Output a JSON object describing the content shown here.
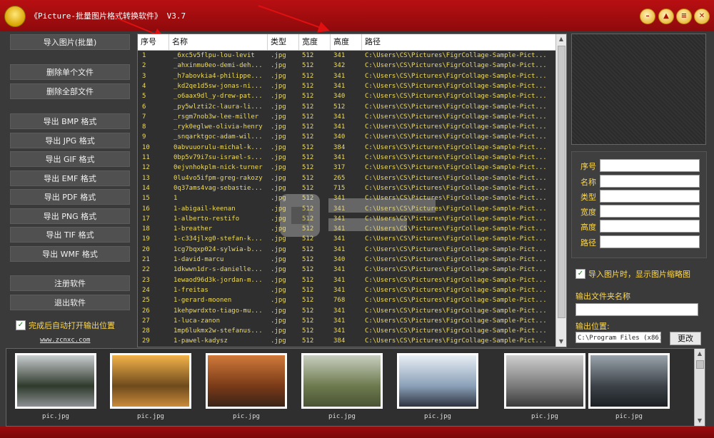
{
  "window": {
    "title": "《Picture-批量图片格式转换软件》 V3.7",
    "controls": [
      "minimize-icon",
      "skin-icon",
      "menu-icon",
      "close-icon"
    ]
  },
  "left_panel": {
    "import_label": "导入图片(批量)",
    "delete_single_label": "删除单个文件",
    "delete_all_label": "删除全部文件",
    "export_labels": [
      "导出 BMP 格式",
      "导出 JPG 格式",
      "导出 GIF 格式",
      "导出 EMF 格式",
      "导出 PDF 格式",
      "导出 PNG 格式",
      "导出 TIF 格式",
      "导出 WMF 格式"
    ],
    "register_label": "注册软件",
    "exit_label": "退出软件",
    "auto_open_label": "完成后自动打开输出位置",
    "auto_open_checked": true,
    "site_link": "www.zcnxc.com"
  },
  "table": {
    "columns": [
      "序号",
      "名称",
      "类型",
      "宽度",
      "高度",
      "路径"
    ],
    "rows": [
      [
        "1",
        "_6xc5v5flpu-lou-levit",
        ".jpg",
        "512",
        "341",
        "C:\\Users\\CS\\Pictures\\FigrCollage-Sample-Pict..."
      ],
      [
        "2",
        "_ahxinmu0eo-demi-deh...",
        ".jpg",
        "512",
        "342",
        "C:\\Users\\CS\\Pictures\\FigrCollage-Sample-Pict..."
      ],
      [
        "3",
        "_h7abovkia4-philippe...",
        ".jpg",
        "512",
        "341",
        "C:\\Users\\CS\\Pictures\\FigrCollage-Sample-Pict..."
      ],
      [
        "4",
        "_kd2qe1d5sw-jonas-ni...",
        ".jpg",
        "512",
        "341",
        "C:\\Users\\CS\\Pictures\\FigrCollage-Sample-Pict..."
      ],
      [
        "5",
        "_o6aax9dl_y-drew-pat...",
        ".jpg",
        "512",
        "340",
        "C:\\Users\\CS\\Pictures\\FigrCollage-Sample-Pict..."
      ],
      [
        "6",
        "_py5wlzti2c-laura-li...",
        ".jpg",
        "512",
        "512",
        "C:\\Users\\CS\\Pictures\\FigrCollage-Sample-Pict..."
      ],
      [
        "7",
        "_rsgm7nob3w-lee-miller",
        ".jpg",
        "512",
        "341",
        "C:\\Users\\CS\\Pictures\\FigrCollage-Sample-Pict..."
      ],
      [
        "8",
        "_ryk0eglwe-olivia-henry",
        ".jpg",
        "512",
        "341",
        "C:\\Users\\CS\\Pictures\\FigrCollage-Sample-Pict..."
      ],
      [
        "9",
        "_snqarktgoc-adam-wil...",
        ".jpg",
        "512",
        "340",
        "C:\\Users\\CS\\Pictures\\FigrCollage-Sample-Pict..."
      ],
      [
        "10",
        "0abvuuorulu-michal-k...",
        ".jpg",
        "512",
        "384",
        "C:\\Users\\CS\\Pictures\\FigrCollage-Sample-Pict..."
      ],
      [
        "11",
        "0bp5v79i7su-israel-s...",
        ".jpg",
        "512",
        "341",
        "C:\\Users\\CS\\Pictures\\FigrCollage-Sample-Pict..."
      ],
      [
        "12",
        "0ejvnhokplm-nick-turner",
        ".jpg",
        "512",
        "317",
        "C:\\Users\\CS\\Pictures\\FigrCollage-Sample-Pict..."
      ],
      [
        "13",
        "0lu4vo5ifpm-greg-rakozy",
        ".jpg",
        "512",
        "265",
        "C:\\Users\\CS\\Pictures\\FigrCollage-Sample-Pict..."
      ],
      [
        "14",
        "0q37ams4vag-sebastie...",
        ".jpg",
        "512",
        "715",
        "C:\\Users\\CS\\Pictures\\FigrCollage-Sample-Pict..."
      ],
      [
        "15",
        "1",
        ".jpg",
        "512",
        "341",
        "C:\\Users\\CS\\Pictures\\FigrCollage-Sample-Pict..."
      ],
      [
        "16",
        "1-abigail-keenan",
        ".jpg",
        "512",
        "341",
        "C:\\Users\\CS\\Pictures\\FigrCollage-Sample-Pict..."
      ],
      [
        "17",
        "1-alberto-restifo",
        ".jpg",
        "512",
        "341",
        "C:\\Users\\CS\\Pictures\\FigrCollage-Sample-Pict..."
      ],
      [
        "18",
        "1-breather",
        ".jpg",
        "512",
        "341",
        "C:\\Users\\CS\\Pictures\\FigrCollage-Sample-Pict..."
      ],
      [
        "19",
        "1-c334jlxg0-stefan-k...",
        ".jpg",
        "512",
        "341",
        "C:\\Users\\CS\\Pictures\\FigrCollage-Sample-Pict..."
      ],
      [
        "20",
        "1cg7bqxp024-sylwia-b...",
        ".jpg",
        "512",
        "341",
        "C:\\Users\\CS\\Pictures\\FigrCollage-Sample-Pict..."
      ],
      [
        "21",
        "1-david-marcu",
        ".jpg",
        "512",
        "340",
        "C:\\Users\\CS\\Pictures\\FigrCollage-Sample-Pict..."
      ],
      [
        "22",
        "1dkwwn1dr-s-danielle...",
        ".jpg",
        "512",
        "341",
        "C:\\Users\\CS\\Pictures\\FigrCollage-Sample-Pict..."
      ],
      [
        "23",
        "1ewaod96d3k-jordan-m...",
        ".jpg",
        "512",
        "341",
        "C:\\Users\\CS\\Pictures\\FigrCollage-Sample-Pict..."
      ],
      [
        "24",
        "1-freitas",
        ".jpg",
        "512",
        "341",
        "C:\\Users\\CS\\Pictures\\FigrCollage-Sample-Pict..."
      ],
      [
        "25",
        "1-gerard-moonen",
        ".jpg",
        "512",
        "768",
        "C:\\Users\\CS\\Pictures\\FigrCollage-Sample-Pict..."
      ],
      [
        "26",
        "1kehpwrdxto-tiago-mu...",
        ".jpg",
        "512",
        "341",
        "C:\\Users\\CS\\Pictures\\FigrCollage-Sample-Pict..."
      ],
      [
        "27",
        "1-luca-zanon",
        ".jpg",
        "512",
        "341",
        "C:\\Users\\CS\\Pictures\\FigrCollage-Sample-Pict..."
      ],
      [
        "28",
        "1mp6lukmx2w-stefanus...",
        ".jpg",
        "512",
        "341",
        "C:\\Users\\CS\\Pictures\\FigrCollage-Sample-Pict..."
      ],
      [
        "29",
        "1-pawel-kadysz",
        ".jpg",
        "512",
        "384",
        "C:\\Users\\CS\\Pictures\\FigrCollage-Sample-Pict..."
      ]
    ]
  },
  "properties": {
    "labels": [
      "序号",
      "名称",
      "类型",
      "宽度",
      "高度",
      "路径"
    ]
  },
  "right_panel": {
    "show_thumb_label": "导入图片时，显示图片缩略图",
    "show_thumb_checked": true,
    "output_folder_label": "输出文件夹名称",
    "output_location_label": "输出位置:",
    "output_path": "C:\\Program Files (x86)",
    "change_label": "更改"
  },
  "thumbnails": [
    {
      "label": "pic.jpg",
      "icon": "road-forest-photo",
      "colors": [
        "#c9cdd0",
        "#2f3a2c",
        "#8b8f92"
      ]
    },
    {
      "label": "pic.jpg",
      "icon": "cactus-sunset-photo",
      "colors": [
        "#f4b34a",
        "#6e4a1c",
        "#c98b3a"
      ]
    },
    {
      "label": "pic.jpg",
      "icon": "rock-canyon-photo",
      "colors": [
        "#d07a3a",
        "#7a3a18",
        "#3a2418"
      ]
    },
    {
      "label": "pic.jpg",
      "icon": "sheep-field-photo",
      "colors": [
        "#c8cfc0",
        "#6d7a4e",
        "#4a5434"
      ]
    },
    {
      "label": "pic.jpg",
      "icon": "hand-laptop-photo",
      "colors": [
        "#e8eef4",
        "#8aa0b8",
        "#2e3340"
      ]
    },
    {
      "label": "pic.jpg",
      "icon": "eiffel-tower-photo",
      "colors": [
        "#cfcfcf",
        "#7a7a7a",
        "#3a3a3a"
      ]
    },
    {
      "label": "pic.jpg",
      "icon": "rocky-coast-photo",
      "colors": [
        "#9aa3ab",
        "#3c4248",
        "#1c2024"
      ]
    }
  ]
}
